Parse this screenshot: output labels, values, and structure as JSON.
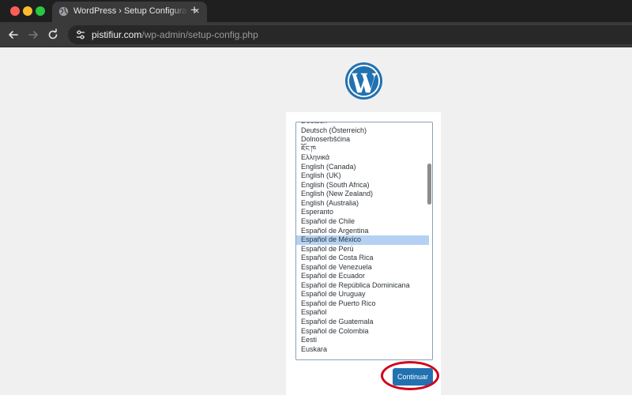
{
  "browser": {
    "tab_title": "WordPress › Setup Configuration",
    "tab_close": "×",
    "new_tab": "+",
    "url_host": "pistifiur.com",
    "url_path": "/wp-admin/setup-config.php"
  },
  "page": {
    "languages": [
      "Deutsch",
      "Deutsch (Österreich)",
      "Dolnoserbšćina",
      "ཇོང་ཁ",
      "Ελληνικά",
      "English (Canada)",
      "English (UK)",
      "English (South Africa)",
      "English (New Zealand)",
      "English (Australia)",
      "Esperanto",
      "Español de Chile",
      "Español de Argentina",
      "Español de México",
      "Español de Perú",
      "Español de Costa Rica",
      "Español de Venezuela",
      "Español de Ecuador",
      "Español de República Dominicana",
      "Español de Uruguay",
      "Español de Puerto Rico",
      "Español",
      "Español de Guatemala",
      "Español de Colombia",
      "Eesti",
      "Euskara"
    ],
    "selected_index": 13,
    "continue_label": "Continuar"
  },
  "colors": {
    "wp_blue": "#2271b1",
    "highlight": "#d0021b",
    "selection": "#b4d1f3"
  }
}
